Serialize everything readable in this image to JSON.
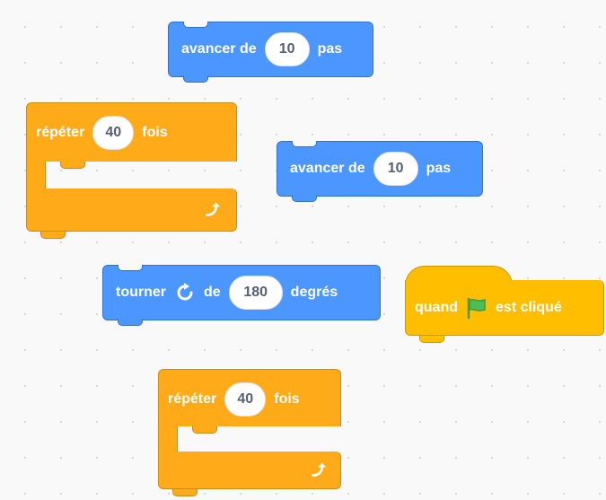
{
  "colors": {
    "motion": "#4c97ff",
    "control": "#ffab19",
    "events": "#ffbf00",
    "canvas": "#f9f9f9"
  },
  "blocks": [
    {
      "prefix": "avancer de",
      "value": "10",
      "suffix": "pas"
    },
    {
      "prefix": "avancer de",
      "value": "10",
      "suffix": "pas"
    },
    {
      "prefix": "tourner",
      "icon": "rotate-clockwise-icon",
      "middle": "de",
      "value": "180",
      "suffix": "degrés"
    }
  ],
  "loops": [
    {
      "prefix": "répéter",
      "value": "40",
      "suffix": "fois",
      "icon": "loop-arrow-icon"
    },
    {
      "prefix": "répéter",
      "value": "40",
      "suffix": "fois",
      "icon": "loop-arrow-icon"
    }
  ],
  "hat": {
    "prefix": "quand",
    "icon": "green-flag-icon",
    "suffix": "est cliqué"
  }
}
